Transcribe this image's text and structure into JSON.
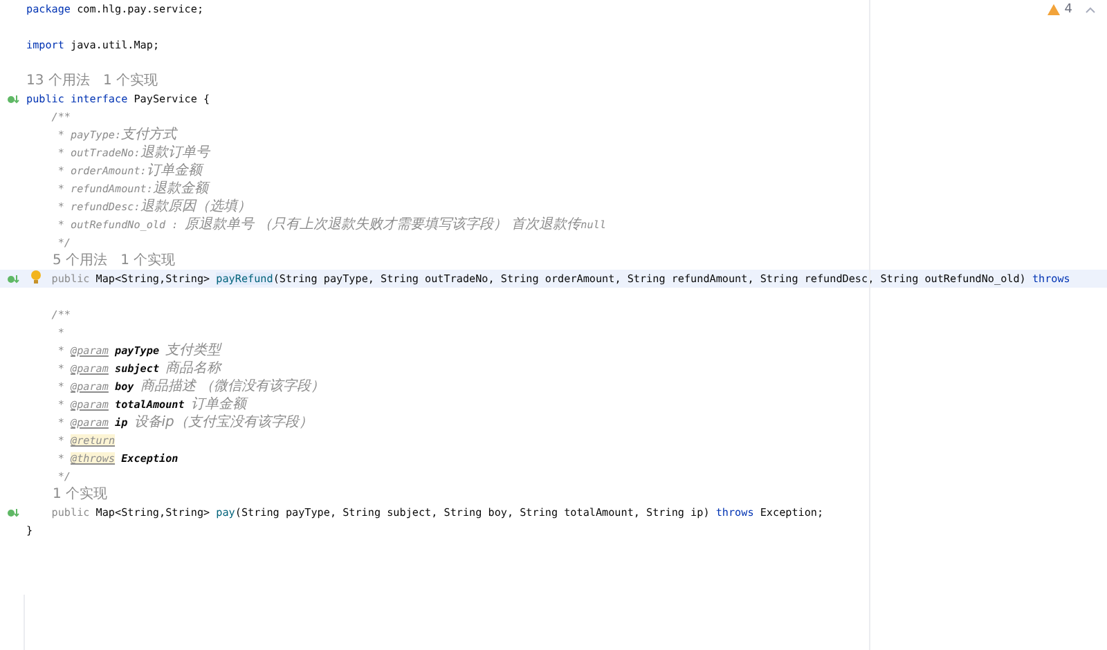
{
  "inspections": {
    "warning_count": "4"
  },
  "lines": [
    {
      "kind": "code",
      "tokens": [
        {
          "kind": "keyword",
          "text": "package"
        },
        {
          "kind": "text",
          "text": " com.hlg.pay.service;"
        }
      ]
    },
    {
      "kind": "blank"
    },
    {
      "kind": "code",
      "tokens": [
        {
          "kind": "keyword",
          "text": "import"
        },
        {
          "kind": "text",
          "text": " java.util.Map;"
        }
      ]
    },
    {
      "kind": "blank"
    },
    {
      "kind": "hint",
      "text": "13 个用法   1 个实现"
    },
    {
      "kind": "code",
      "implemented": true,
      "tokens": [
        {
          "kind": "keyword",
          "text": "public interface"
        },
        {
          "kind": "text",
          "text": " PayService {"
        }
      ]
    },
    {
      "kind": "code",
      "tokens": [
        {
          "kind": "comment",
          "text": "    /**"
        }
      ]
    },
    {
      "kind": "code",
      "tokens": [
        {
          "kind": "comment",
          "text": "     * payType:"
        },
        {
          "kind": "cjk",
          "text": "支付方式"
        }
      ]
    },
    {
      "kind": "code",
      "tokens": [
        {
          "kind": "comment",
          "text": "     * outTradeNo:"
        },
        {
          "kind": "cjk",
          "text": "退款订单号"
        }
      ]
    },
    {
      "kind": "code",
      "tokens": [
        {
          "kind": "comment",
          "text": "     * orderAmount:"
        },
        {
          "kind": "cjk",
          "text": "订单金额"
        }
      ]
    },
    {
      "kind": "code",
      "tokens": [
        {
          "kind": "comment",
          "text": "     * refundAmount:"
        },
        {
          "kind": "cjk",
          "text": "退款金额"
        }
      ]
    },
    {
      "kind": "code",
      "tokens": [
        {
          "kind": "comment",
          "text": "     * refundDesc:"
        },
        {
          "kind": "cjk",
          "text": "退款原因（选填）"
        }
      ]
    },
    {
      "kind": "code",
      "tokens": [
        {
          "kind": "comment",
          "text": "     * outRefundNo_old : "
        },
        {
          "kind": "cjk",
          "text": "原退款单号 （只有上次退款失败才需要填写该字段） 首次退款传"
        },
        {
          "kind": "comment",
          "text": "null"
        }
      ]
    },
    {
      "kind": "code",
      "tokens": [
        {
          "kind": "comment",
          "text": "     */"
        }
      ]
    },
    {
      "kind": "hint",
      "indented": true,
      "text": "5 个用法   1 个实现"
    },
    {
      "kind": "code",
      "implemented": true,
      "bulb": true,
      "current": true,
      "tokens": [
        {
          "kind": "keyword-muted",
          "text": "    public"
        },
        {
          "kind": "text",
          "text": " Map<String,String> "
        },
        {
          "kind": "method-marked",
          "text": "payRefund"
        },
        {
          "kind": "text",
          "text": "(String payType, String outTradeNo, String orderAmount, String refundAmount, String refundDesc, String outRefundNo_old) "
        },
        {
          "kind": "keyword",
          "text": "throws"
        }
      ]
    },
    {
      "kind": "blank"
    },
    {
      "kind": "code",
      "tokens": [
        {
          "kind": "comment",
          "text": "    /**"
        }
      ]
    },
    {
      "kind": "code",
      "tokens": [
        {
          "kind": "comment",
          "text": "     *"
        }
      ]
    },
    {
      "kind": "code",
      "tokens": [
        {
          "kind": "comment",
          "text": "     * "
        },
        {
          "kind": "doc-tag",
          "text": "@param"
        },
        {
          "kind": "doc-ref",
          "text": " payType "
        },
        {
          "kind": "cjk",
          "text": "支付类型"
        }
      ]
    },
    {
      "kind": "code",
      "tokens": [
        {
          "kind": "comment",
          "text": "     * "
        },
        {
          "kind": "doc-tag",
          "text": "@param"
        },
        {
          "kind": "doc-ref",
          "text": " subject "
        },
        {
          "kind": "cjk",
          "text": "商品名称"
        }
      ]
    },
    {
      "kind": "code",
      "tokens": [
        {
          "kind": "comment",
          "text": "     * "
        },
        {
          "kind": "doc-tag",
          "text": "@param"
        },
        {
          "kind": "doc-ref",
          "text": " boy "
        },
        {
          "kind": "cjk",
          "text": "商品描述 （微信没有该字段）"
        }
      ]
    },
    {
      "kind": "code",
      "tokens": [
        {
          "kind": "comment",
          "text": "     * "
        },
        {
          "kind": "doc-tag",
          "text": "@param"
        },
        {
          "kind": "doc-ref",
          "text": " totalAmount "
        },
        {
          "kind": "cjk",
          "text": "订单金额"
        }
      ]
    },
    {
      "kind": "code",
      "tokens": [
        {
          "kind": "comment",
          "text": "     * "
        },
        {
          "kind": "doc-tag",
          "text": "@param"
        },
        {
          "kind": "doc-ref",
          "text": " ip "
        },
        {
          "kind": "cjk",
          "text": "设备ip（支付宝没有该字段）"
        }
      ]
    },
    {
      "kind": "code",
      "tokens": [
        {
          "kind": "comment",
          "text": "     * "
        },
        {
          "kind": "doc-tag-marked",
          "text": "@return"
        }
      ]
    },
    {
      "kind": "code",
      "tokens": [
        {
          "kind": "comment",
          "text": "     * "
        },
        {
          "kind": "doc-tag-marked",
          "text": "@throws"
        },
        {
          "kind": "doc-ref",
          "text": " Exception"
        }
      ]
    },
    {
      "kind": "code",
      "tokens": [
        {
          "kind": "comment",
          "text": "     */"
        }
      ]
    },
    {
      "kind": "hint",
      "indented": true,
      "text": "1 个实现"
    },
    {
      "kind": "code",
      "implemented": true,
      "tokens": [
        {
          "kind": "keyword-muted",
          "text": "    public"
        },
        {
          "kind": "text",
          "text": " Map<String,String> "
        },
        {
          "kind": "method",
          "text": "pay"
        },
        {
          "kind": "text",
          "text": "(String payType, String subject, String boy, String totalAmount, String ip) "
        },
        {
          "kind": "keyword",
          "text": "throws"
        },
        {
          "kind": "text",
          "text": " Exception;"
        }
      ]
    },
    {
      "kind": "code",
      "tokens": [
        {
          "kind": "text",
          "text": "}"
        }
      ]
    }
  ]
}
